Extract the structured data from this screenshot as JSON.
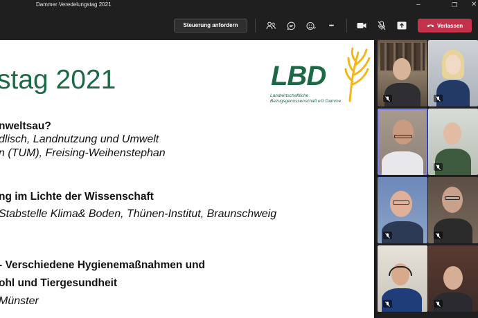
{
  "window": {
    "title": "Dammer Veredelungstag 2021"
  },
  "window_controls": {
    "minimize": "–",
    "maximize": "❐",
    "close": "✕"
  },
  "toolbar": {
    "control_request": "Steuerung anfordern",
    "leave": "Verlassen",
    "more": "•••"
  },
  "slide": {
    "title": "stag 2021",
    "logo": {
      "text": "LBD",
      "subtitle_line1": "Landwirtschaftliche",
      "subtitle_line2": "Bezugsgenossenschaft eG Damme"
    },
    "lines": [
      "nweltsau?",
      "dlisch, Landnutzung und Umwelt",
      "n (TUM), Freising-Weihenstephan",
      "ng im Lichte der Wissenschaft",
      "Stabstelle Klima& Boden, Thünen-Institut, Braunschweig",
      "- Verschiedene Hygienemaßnahmen und",
      "ohl und Tiergesundheit",
      "Münster"
    ]
  },
  "participants": [
    {
      "muted": true,
      "active": false
    },
    {
      "muted": true,
      "active": false
    },
    {
      "muted": false,
      "active": true
    },
    {
      "muted": true,
      "active": false
    },
    {
      "muted": true,
      "active": false
    },
    {
      "muted": true,
      "active": false
    },
    {
      "muted": true,
      "active": false
    },
    {
      "muted": true,
      "active": false
    }
  ],
  "colors": {
    "accent_green": "#1b6a45",
    "logo_yellow": "#f2b81b",
    "leave_red": "#c4314b",
    "active_outline": "#7f85f5"
  }
}
